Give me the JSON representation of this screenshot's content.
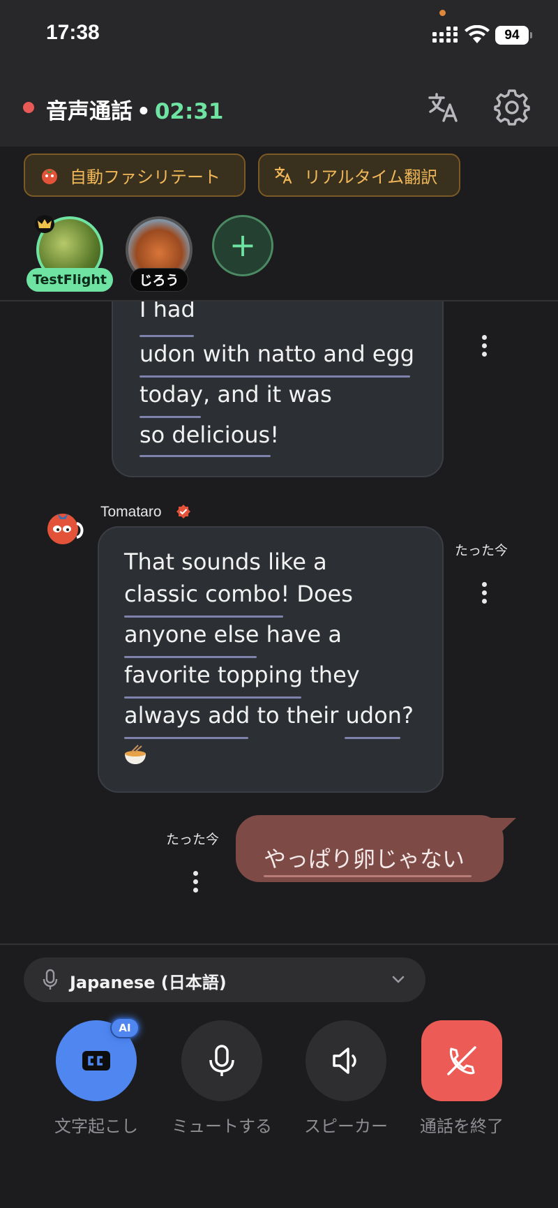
{
  "status_bar": {
    "time": "17:38",
    "battery": "94"
  },
  "header": {
    "title": "音声通話",
    "separator": "•",
    "timer": "02:31"
  },
  "pills": {
    "facilitate": "自動ファシリテート",
    "translate": "リアルタイム翻訳"
  },
  "participants": [
    {
      "name": "TestFlight",
      "host": true
    },
    {
      "name": "じろう",
      "host": false
    }
  ],
  "messages": {
    "previous": {
      "lines": [
        "I had",
        "udon with natto and egg",
        "today, and it was",
        "so delicious!"
      ]
    },
    "bot": {
      "sender": "Tomataro",
      "timestamp": "たった今",
      "lines": [
        "That sounds like a",
        "classic combo! Does",
        "anyone else have a",
        "favorite topping they",
        "always add to their udon?"
      ],
      "emoji": "ramen-bowl"
    },
    "mine": {
      "timestamp": "たった今",
      "text": "やっぱり卵じゃない"
    }
  },
  "language_selector": {
    "label": "Japanese (日本語)"
  },
  "controls": {
    "transcribe": "文字起こし",
    "ai_badge": "AI",
    "mute": "ミュートする",
    "speaker": "スピーカー",
    "end_call": "通話を終了"
  },
  "colors": {
    "accent_green": "#6fe3a2",
    "end_red": "#ec5b56",
    "cc_blue": "#4f86f0",
    "pill_gold": "#f0b858",
    "my_bubble": "#7e4a45"
  }
}
